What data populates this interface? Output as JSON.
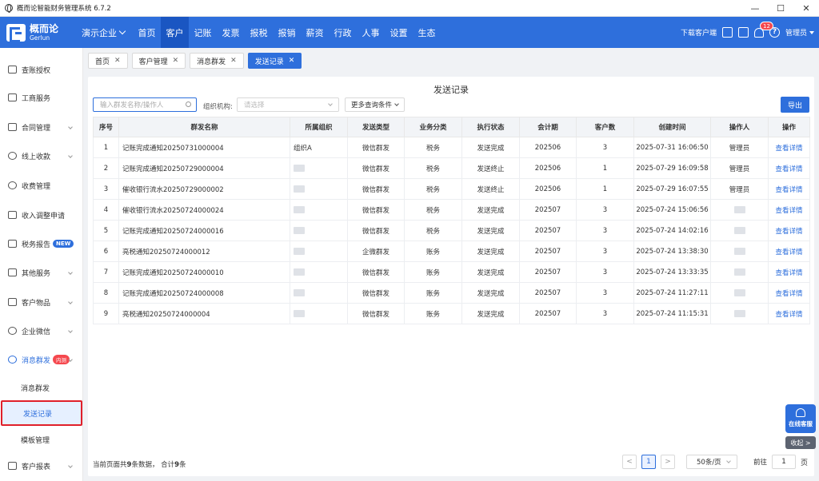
{
  "window": {
    "title": "概而论智能财务管理系统 6.7.2",
    "min": "—",
    "max": "☐",
    "close": "✕"
  },
  "brand": {
    "name_cn": "概而论",
    "name_en": "Gerlun"
  },
  "company": "演示企业",
  "menu": [
    "首页",
    "客户",
    "记账",
    "发票",
    "报税",
    "报销",
    "薪资",
    "行政",
    "人事",
    "设置",
    "生态"
  ],
  "active_menu": "客户",
  "nav_right": {
    "download": "下载客户端",
    "badge": "12",
    "help": "?",
    "user": "管理员"
  },
  "sidebar": {
    "items": [
      {
        "label": "查账授权",
        "arrow": false
      },
      {
        "label": "工商服务",
        "arrow": false
      },
      {
        "label": "合同管理",
        "arrow": true
      },
      {
        "label": "线上收款",
        "arrow": true
      },
      {
        "label": "收费管理",
        "arrow": false
      },
      {
        "label": "收入调整申请",
        "arrow": false
      },
      {
        "label": "税务报告",
        "arrow": false,
        "tag": "NEW"
      },
      {
        "label": "其他服务",
        "arrow": true
      },
      {
        "label": "客户物品",
        "arrow": true
      },
      {
        "label": "企业微信",
        "arrow": true
      },
      {
        "label": "消息群发",
        "arrow": true,
        "tag": "内测"
      }
    ],
    "subitems": [
      "消息群发",
      "发送记录",
      "模板管理"
    ],
    "bottom": {
      "label": "客户报表"
    }
  },
  "tabs": [
    {
      "label": "首页"
    },
    {
      "label": "客户管理"
    },
    {
      "label": "消息群发"
    },
    {
      "label": "发送记录",
      "active": true
    }
  ],
  "page": {
    "title": "发送记录",
    "search_placeholder": "输入群发名称/操作人",
    "org_label": "组织机构:",
    "org_placeholder": "请选择",
    "more_filters": "更多查询条件",
    "export": "导出"
  },
  "table": {
    "headers": [
      "序号",
      "群发名称",
      "所属组织",
      "发送类型",
      "业务分类",
      "执行状态",
      "会计期",
      "客户数",
      "创建时间",
      "操作人",
      "操作"
    ],
    "rows": [
      [
        "1",
        "记账完成通知20250731000004",
        "组织A",
        "微信群发",
        "税务",
        "发送完成",
        "202506",
        "3",
        "2025-07-31 16:06:50",
        "管理员",
        "查看详情"
      ],
      [
        "2",
        "记账完成通知20250729000004",
        "",
        "微信群发",
        "税务",
        "发送终止",
        "202506",
        "1",
        "2025-07-29 16:09:58",
        "管理员",
        "查看详情"
      ],
      [
        "3",
        "催收银行流水20250729000002",
        "",
        "微信群发",
        "税务",
        "发送终止",
        "202506",
        "1",
        "2025-07-29 16:07:55",
        "管理员",
        "查看详情"
      ],
      [
        "4",
        "催收银行流水20250724000024",
        "",
        "微信群发",
        "税务",
        "发送完成",
        "202507",
        "3",
        "2025-07-24 15:06:56",
        "",
        "查看详情"
      ],
      [
        "5",
        "记账完成通知20250724000016",
        "",
        "微信群发",
        "税务",
        "发送完成",
        "202507",
        "3",
        "2025-07-24 14:02:16",
        "",
        "查看详情"
      ],
      [
        "6",
        "亮税通知20250724000012",
        "",
        "企微群发",
        "账务",
        "发送完成",
        "202507",
        "3",
        "2025-07-24 13:38:30",
        "",
        "查看详情"
      ],
      [
        "7",
        "记账完成通知20250724000010",
        "",
        "微信群发",
        "账务",
        "发送完成",
        "202507",
        "3",
        "2025-07-24 13:33:35",
        "",
        "查看详情"
      ],
      [
        "8",
        "记账完成通知20250724000008",
        "",
        "微信群发",
        "账务",
        "发送完成",
        "202507",
        "3",
        "2025-07-24 11:27:11",
        "",
        "查看详情"
      ],
      [
        "9",
        "亮税通知20250724000004",
        "",
        "微信群发",
        "账务",
        "发送完成",
        "202507",
        "3",
        "2025-07-24 11:15:31",
        "",
        "查看详情"
      ]
    ]
  },
  "footer": {
    "info_prefix": "当前页面共",
    "info_count": "9",
    "info_mid": "条数据，  合计",
    "info_total": "9",
    "info_suffix": "条",
    "prev": "<",
    "page": "1",
    "next": ">",
    "page_size": "50条/页",
    "goto_label": "前往",
    "goto_value": "1",
    "goto_suffix": "页"
  },
  "floating": {
    "service": "在线客服",
    "collapse": "收起 >"
  }
}
